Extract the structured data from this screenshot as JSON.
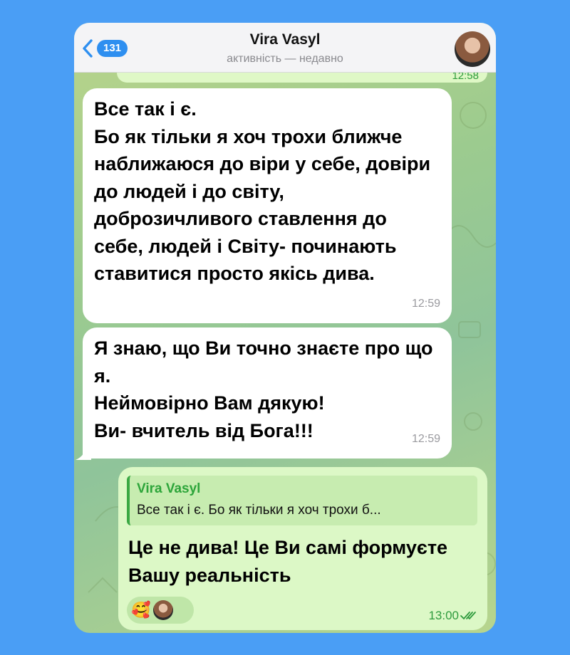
{
  "header": {
    "back_count": "131",
    "name": "Vira Vasyl",
    "status": "активність — недавно"
  },
  "previous_time": "12:58",
  "messages": [
    {
      "lines": [
        "Все так і є.",
        "Бо як тільки я хоч трохи ближче наближаюся до віри у себе, довіри до людей і до світу, доброзичливого ставлення до себе, людей і Світу- починають ставитися просто якісь дива."
      ],
      "time": "12:59"
    },
    {
      "lines": [
        "Я знаю, що Ви точно знаєте про що я.",
        "Неймовірно Вам дякую!",
        "Ви- вчитель від Бога!!!"
      ],
      "time": "12:59"
    }
  ],
  "outgoing": {
    "reply_name": "Vira Vasyl",
    "reply_snippet": "Все так і є. Бо як тільки я хоч трохи б...",
    "text": "Це не дива! Це Ви самі формуєте Вашу реальність",
    "reaction_emoji": "🥰",
    "time": "13:00"
  },
  "colors": {
    "accent": "#2e8ff0",
    "outgoing_bubble": "#dcf8c6",
    "reply_name": "#2da53a",
    "frame": "#4a9ef5"
  }
}
